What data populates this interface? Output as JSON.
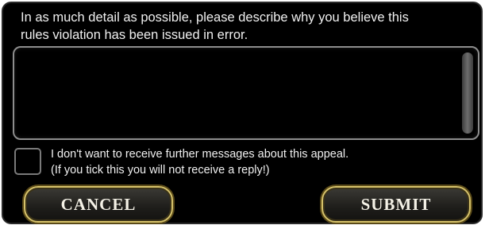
{
  "dialog": {
    "prompt_line1": "In as much detail as possible, please describe why you believe this",
    "prompt_line2": "rules violation has been issued in error.",
    "textarea_value": "",
    "checkbox_checked": false,
    "checkbox_line1": "I don't want to receive further messages about this appeal.",
    "checkbox_line2": "(If you tick this you will not receive a reply!)",
    "cancel_label": "CANCEL",
    "submit_label": "SUBMIT"
  },
  "colors": {
    "background": "#000000",
    "text": "#f0f0f0",
    "button_border": "#d6c26a"
  }
}
